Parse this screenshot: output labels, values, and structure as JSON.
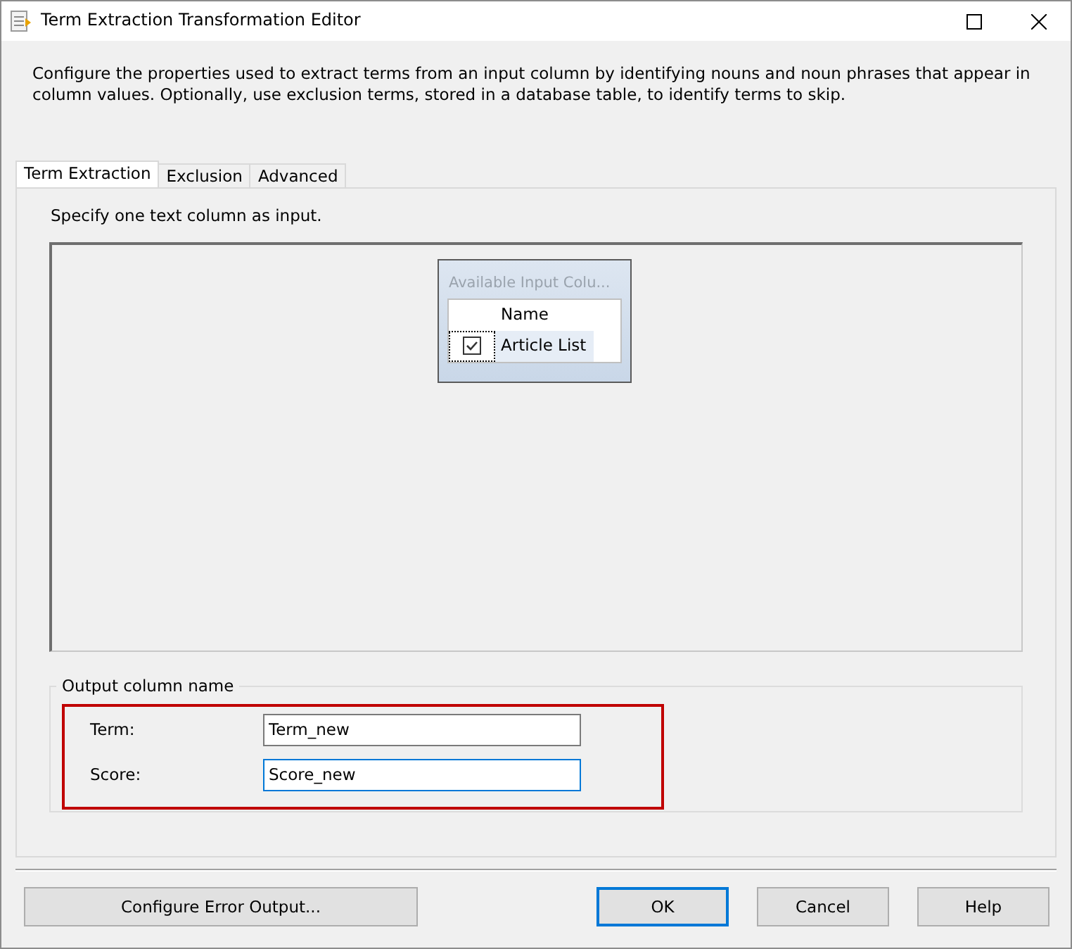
{
  "window": {
    "title": "Term Extraction Transformation Editor"
  },
  "description": "Configure the properties used to extract terms from an input column by identifying nouns and noun phrases that appear in column values. Optionally, use exclusion terms, stored in a database table, to identify terms to skip.",
  "tabs": [
    {
      "label": "Term Extraction",
      "selected": true
    },
    {
      "label": "Exclusion",
      "selected": false
    },
    {
      "label": "Advanced",
      "selected": false
    }
  ],
  "instruction": "Specify one text column as input.",
  "input_columns": {
    "title": "Available Input Colu...",
    "columns": [
      "Name"
    ],
    "rows": [
      {
        "name": "Article List",
        "checked": true
      }
    ]
  },
  "output_group": {
    "title": "Output column name",
    "fields": [
      {
        "label": "Term:",
        "value": "Term_new",
        "focused": false
      },
      {
        "label": "Score:",
        "value": "Score_new",
        "focused": true
      }
    ]
  },
  "buttons": [
    {
      "label": "Configure Error Output...",
      "default": false
    },
    {
      "label": "OK",
      "default": true
    },
    {
      "label": "Cancel",
      "default": false
    },
    {
      "label": "Help",
      "default": false
    }
  ]
}
